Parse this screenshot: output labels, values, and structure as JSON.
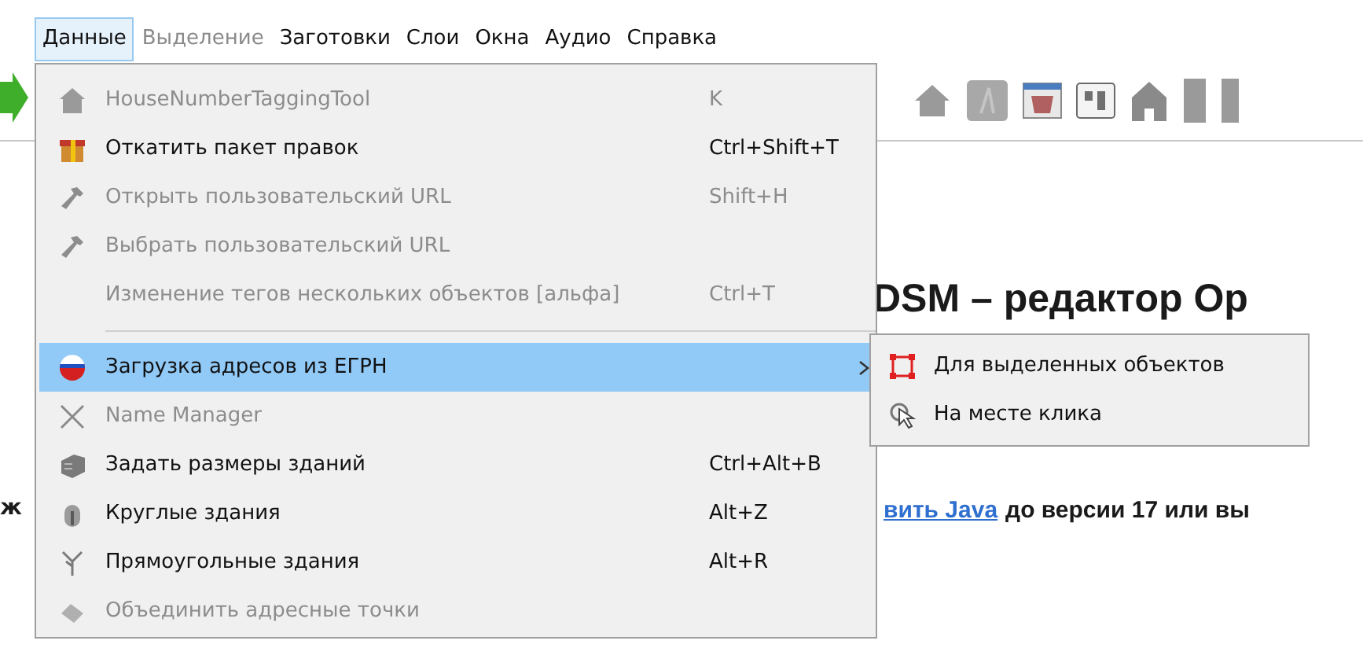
{
  "menubar": [
    {
      "label": "Данные",
      "selected": true,
      "disabled": false
    },
    {
      "label": "Выделение",
      "selected": false,
      "disabled": true
    },
    {
      "label": "Заготовки",
      "selected": false,
      "disabled": false
    },
    {
      "label": "Слои",
      "selected": false,
      "disabled": false
    },
    {
      "label": "Окна",
      "selected": false,
      "disabled": false
    },
    {
      "label": "Аудио",
      "selected": false,
      "disabled": false
    },
    {
      "label": "Справка",
      "selected": false,
      "disabled": false
    }
  ],
  "page": {
    "heading": "DSM – редактор Op",
    "left_fragment": "ж",
    "link": "вить Java",
    "text": "до версии 17 или вы"
  },
  "menu": [
    {
      "kind": "item",
      "label": "HouseNumberTaggingTool",
      "shortcut": "K",
      "disabled": true,
      "selected": false
    },
    {
      "kind": "item",
      "label": "Откатить пакет правок",
      "shortcut": "Ctrl+Shift+T",
      "disabled": false,
      "selected": false
    },
    {
      "kind": "item",
      "label": "Открыть пользовательский URL",
      "shortcut": "Shift+H",
      "disabled": true,
      "selected": false
    },
    {
      "kind": "item",
      "label": "Выбрать пользовательский URL",
      "disabled": true,
      "selected": false
    },
    {
      "kind": "item",
      "label": "Изменение тегов нескольких объектов [альфа]",
      "shortcut": "Ctrl+T",
      "disabled": true,
      "selected": false
    },
    {
      "kind": "separator"
    },
    {
      "kind": "submenu",
      "label": "Загрузка адресов из ЕГРН",
      "disabled": false,
      "selected": true
    },
    {
      "kind": "item",
      "label": "Name Manager",
      "disabled": true,
      "selected": false
    },
    {
      "kind": "item",
      "label": "Задать размеры зданий",
      "shortcut": "Ctrl+Alt+B",
      "disabled": false,
      "selected": false
    },
    {
      "kind": "item",
      "label": "Круглые здания",
      "shortcut": "Alt+Z",
      "disabled": false,
      "selected": false
    },
    {
      "kind": "item",
      "label": "Прямоугольные здания",
      "shortcut": "Alt+R",
      "disabled": false,
      "selected": false
    },
    {
      "kind": "item",
      "label": "Объединить адресные точки",
      "disabled": true,
      "selected": false
    }
  ],
  "submenu": [
    {
      "label": "Для выделенных объектов"
    },
    {
      "label": "На месте клика"
    }
  ]
}
